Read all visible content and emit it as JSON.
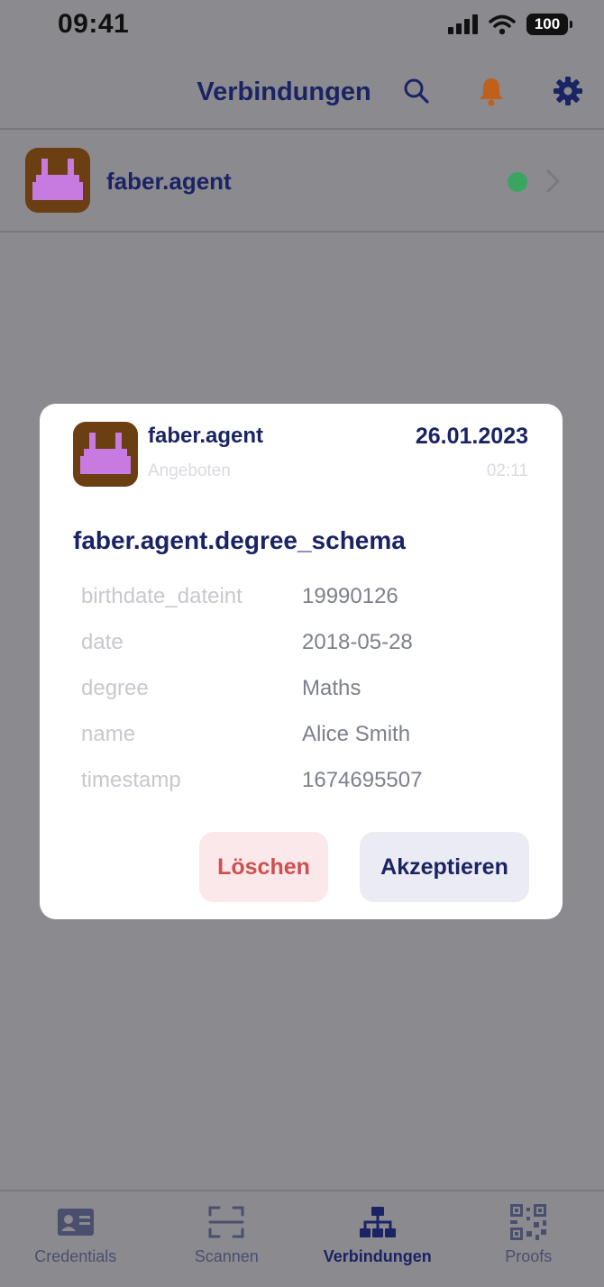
{
  "status_bar": {
    "time": "09:41",
    "battery": "100"
  },
  "header": {
    "title": "Verbindungen",
    "icons": [
      "search-icon",
      "bell-icon",
      "gear-icon"
    ],
    "bell_color": "#c0601a"
  },
  "connections": [
    {
      "name": "faber.agent",
      "status_color": "#3aa561"
    }
  ],
  "modal": {
    "issuer": "faber.agent",
    "status": "Angeboten",
    "date": "26.01.2023",
    "time": "02:11",
    "schema": "faber.agent.degree_schema",
    "attributes": [
      {
        "name": "birthdate_dateint",
        "value": "19990126"
      },
      {
        "name": "date",
        "value": "2018-05-28"
      },
      {
        "name": "degree",
        "value": "Maths"
      },
      {
        "name": "name",
        "value": "Alice Smith"
      },
      {
        "name": "timestamp",
        "value": "1674695507"
      }
    ],
    "delete_label": "Löschen",
    "accept_label": "Akzeptieren"
  },
  "tabs": [
    {
      "label": "Credentials",
      "icon": "id-card-icon",
      "active": false
    },
    {
      "label": "Scannen",
      "icon": "scan-icon",
      "active": false
    },
    {
      "label": "Verbindungen",
      "icon": "network-icon",
      "active": true
    },
    {
      "label": "Proofs",
      "icon": "qr-code-icon",
      "active": false
    }
  ],
  "colors": {
    "primary": "#1a2464",
    "overlay": "#8b8a8f",
    "danger": "#cf4f4f",
    "avatar_bg": "#6b3f11",
    "avatar_fg": "#c77be0"
  }
}
